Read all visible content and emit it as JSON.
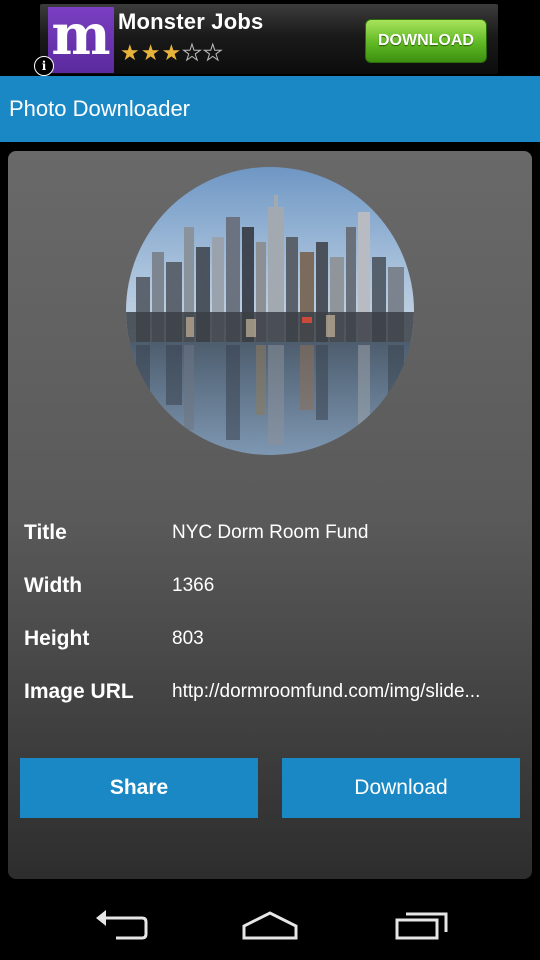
{
  "ad": {
    "title": "Monster Jobs",
    "logo_letter": "m",
    "rating": 3,
    "rating_max": 5,
    "stars_filled": "★★★",
    "stars_empty": "★★",
    "cta": "DOWNLOAD",
    "info": "i"
  },
  "actionbar": {
    "title": "Photo Downloader"
  },
  "details": [
    {
      "label": "Title",
      "value": "NYC Dorm Room Fund"
    },
    {
      "label": "Width",
      "value": "1366"
    },
    {
      "label": "Height",
      "value": "803"
    },
    {
      "label": "Image URL",
      "value": "http://dormroomfund.com/img/slide..."
    }
  ],
  "buttons": {
    "share": "Share",
    "download": "Download"
  },
  "navbar": {
    "back_icon": "back-icon",
    "home_icon": "home-icon",
    "recents_icon": "recents-icon"
  },
  "colors": {
    "accent": "#1a88c4",
    "ad_button": "#5fb824",
    "ad_logo": "#6a35b0"
  }
}
